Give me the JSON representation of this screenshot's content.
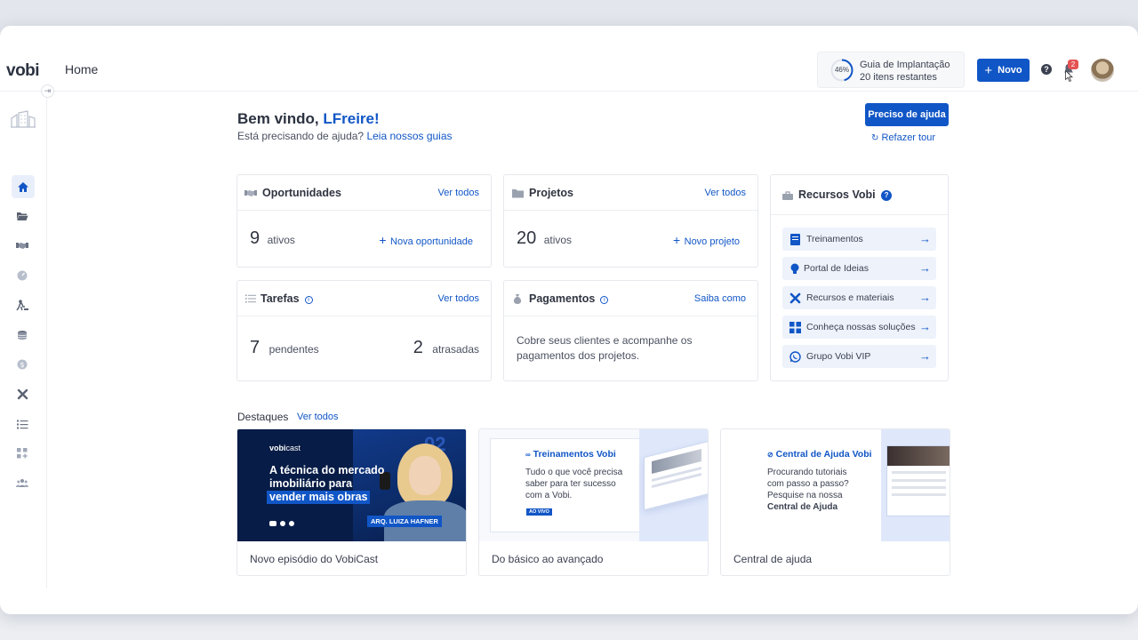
{
  "app": {
    "logo": "vobi",
    "page_title": "Home"
  },
  "header": {
    "guide_percent": "46%",
    "guide_title": "Guia de Implantação",
    "guide_subtitle": "20 itens restantes",
    "new_button": "Novo",
    "help_glyph": "?",
    "notifications_count": "2"
  },
  "sidebar": {
    "collapse_glyph": "⇥",
    "items": [
      {
        "icon": "home-icon"
      },
      {
        "icon": "folder-icon"
      },
      {
        "icon": "handshake-icon"
      },
      {
        "icon": "gauge-icon"
      },
      {
        "icon": "worker-icon"
      },
      {
        "icon": "coins-icon"
      },
      {
        "icon": "dollar-icon"
      },
      {
        "icon": "tools-icon"
      },
      {
        "icon": "list-icon"
      },
      {
        "icon": "apps-icon"
      },
      {
        "icon": "users-icon"
      }
    ]
  },
  "welcome": {
    "greeting": "Bem vindo,",
    "user": "LFreire!",
    "sub_prefix": "Está precisando de ajuda?",
    "sub_link": "Leia nossos guias",
    "help_button": "Preciso de ajuda",
    "redo_tour": "Refazer tour"
  },
  "cards": {
    "oportunidades": {
      "title": "Oportunidades",
      "link": "Ver todos",
      "count": "9",
      "count_label": "ativos",
      "action": "Nova oportunidade"
    },
    "projetos": {
      "title": "Projetos",
      "link": "Ver todos",
      "count": "20",
      "count_label": "ativos",
      "action": "Novo projeto"
    },
    "tarefas": {
      "title": "Tarefas",
      "link": "Ver todos",
      "pending": "7",
      "pending_label": "pendentes",
      "late": "2",
      "late_label": "atrasadas"
    },
    "pagamentos": {
      "title": "Pagamentos",
      "link": "Saiba como",
      "text": "Cobre seus clientes e acompanhe os pagamentos dos projetos."
    }
  },
  "resources": {
    "title": "Recursos Vobi",
    "items": [
      {
        "label": "Treinamentos",
        "icon": "book-icon"
      },
      {
        "label": "Portal de Ideias",
        "icon": "lightbulb-icon"
      },
      {
        "label": "Recursos e materiais",
        "icon": "tools-icon"
      },
      {
        "label": "Conheça nossas soluções",
        "icon": "puzzle-icon"
      },
      {
        "label": "Grupo Vobi VIP",
        "icon": "whatsapp-icon"
      }
    ]
  },
  "highlights": {
    "title": "Destaques",
    "link": "Ver todos",
    "items": [
      {
        "caption": "Novo episódio do VobiCast",
        "brand_bold": "vobi",
        "brand_light": "cast",
        "line1": "A técnica do mercado",
        "line2": "imobiliário para",
        "line3": "vender mais obras",
        "guest": "ARQ. LUIZA HAFNER",
        "episode": "02"
      },
      {
        "caption": "Do básico ao avançado",
        "card_title": "Treinamentos Vobi",
        "card_text": "Tudo o que você precisa saber para ter sucesso com a Vobi.",
        "tag": "AO VIVO"
      },
      {
        "caption": "Central de ajuda",
        "card_title": "Central de Ajuda Vobi",
        "card_text": "Procurando tutoriais com passo a passo? Pesquise na nossa",
        "card_bold": "Central de Ajuda"
      }
    ]
  },
  "colors": {
    "primary": "#1156c6",
    "badge": "#e55353",
    "resource_bg": "#edf2fb",
    "podcast_bg": "#071c46"
  }
}
